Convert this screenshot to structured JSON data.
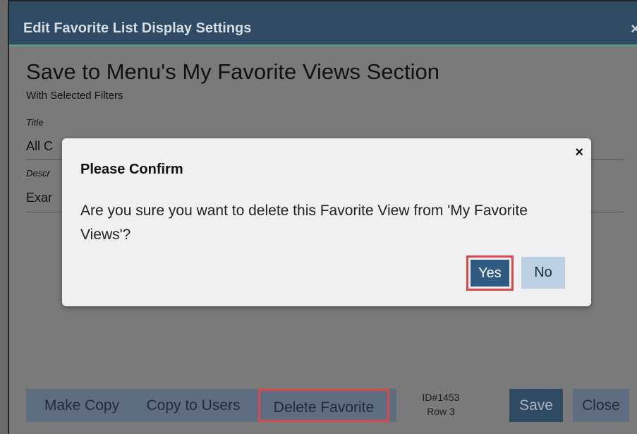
{
  "window": {
    "title": "Edit Favorite List Display Settings",
    "close_glyph": "×"
  },
  "section": {
    "heading": "Save to Menu's My Favorite Views Section",
    "subheading": "With Selected Filters"
  },
  "fields": {
    "title_label": "Title",
    "title_value": "All C",
    "description_label": "Descr",
    "description_value": "Exar"
  },
  "footer": {
    "make_copy_label": "Make Copy",
    "copy_to_users_label": "Copy to Users",
    "delete_favorite_label": "Delete Favorite",
    "id_text": "ID#1453",
    "row_text": "Row 3",
    "save_label": "Save",
    "close_label": "Close"
  },
  "confirm": {
    "title": "Please Confirm",
    "message": "Are you sure you want to delete this Favorite View from 'My Favorite Views'?",
    "yes_label": "Yes",
    "no_label": "No",
    "close_glyph": "×"
  }
}
